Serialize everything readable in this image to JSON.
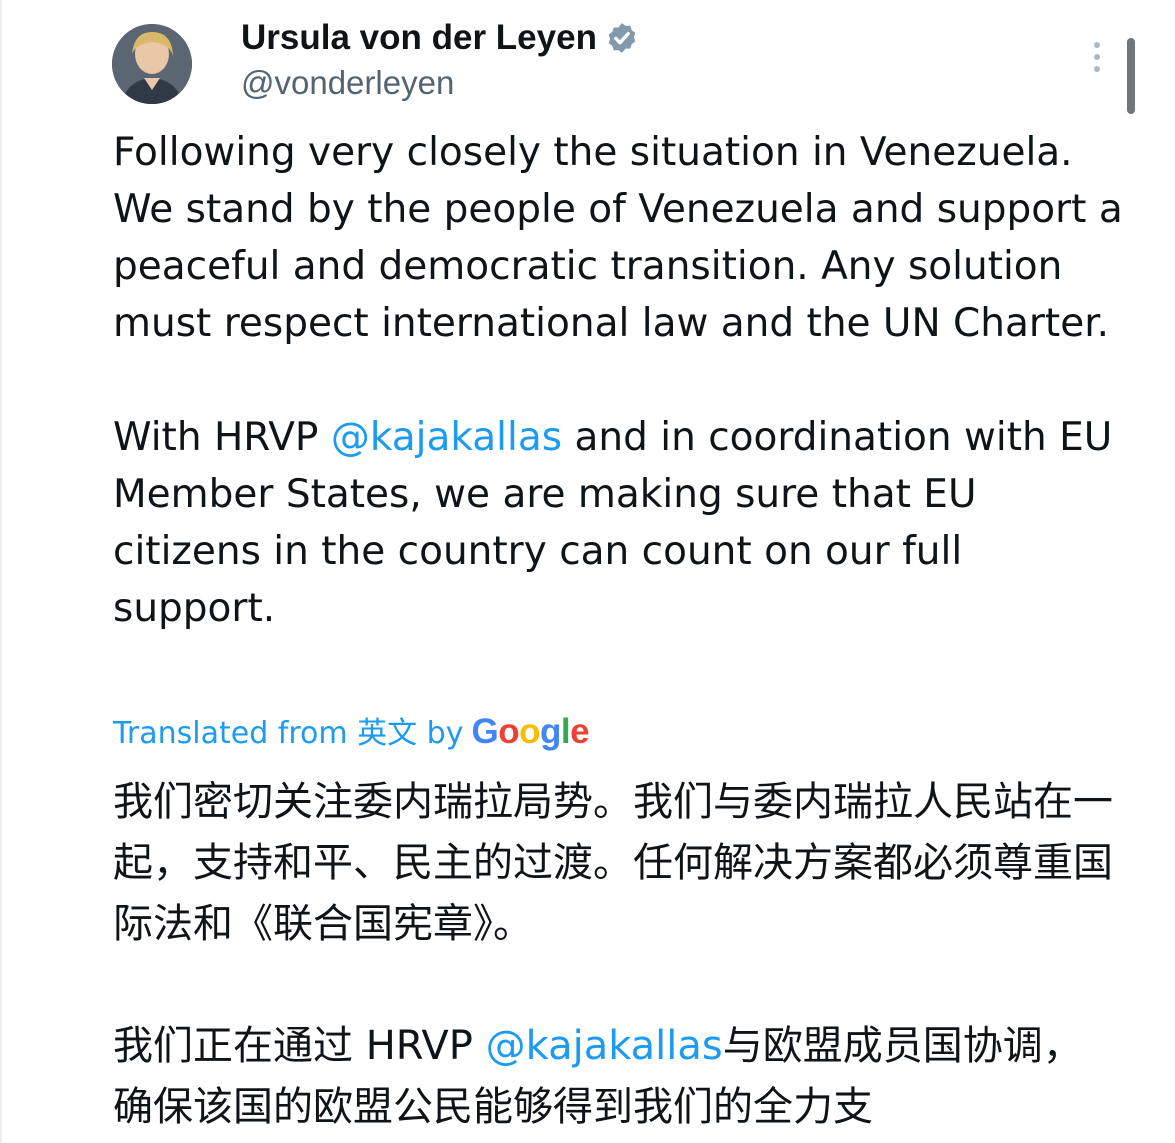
{
  "author": {
    "name": "Ursula von der Leyen",
    "handle": "@vonderleyen",
    "verified": true
  },
  "tweet": {
    "p1": "Following very closely the situation in Venezuela. We stand by the people of Venezuela and support a peaceful and democratic transition. Any solution must respect international law and the UN Charter.",
    "p2_before": "With HRVP ",
    "p2_mention": "@kajakallas",
    "p2_after": " and in coordination with EU Member States, we are making sure that EU citizens in the country can count on our full support."
  },
  "translation_notice": {
    "label": "Translated from 英文 by",
    "provider_letters": [
      "G",
      "o",
      "o",
      "g",
      "l",
      "e"
    ]
  },
  "translation": {
    "p1": "我们密切关注委内瑞拉局势。我们与委内瑞拉人民站在一起，支持和平、民主的过渡。任何解决方案都必须尊重国际法和《联合国宪章》。",
    "p2_before": "我们正在通过 HRVP ",
    "p2_mention": "@kajakallas",
    "p2_after": "与欧盟成员国协调，确保该国的欧盟公民能够得到我们的全力支"
  },
  "colors": {
    "link": "#1d9bf0",
    "text": "#0f1419",
    "secondary": "#536471",
    "verified": "#829aab"
  },
  "icons": {
    "more": "more-vertical-icon",
    "verified": "verified-badge-icon"
  }
}
